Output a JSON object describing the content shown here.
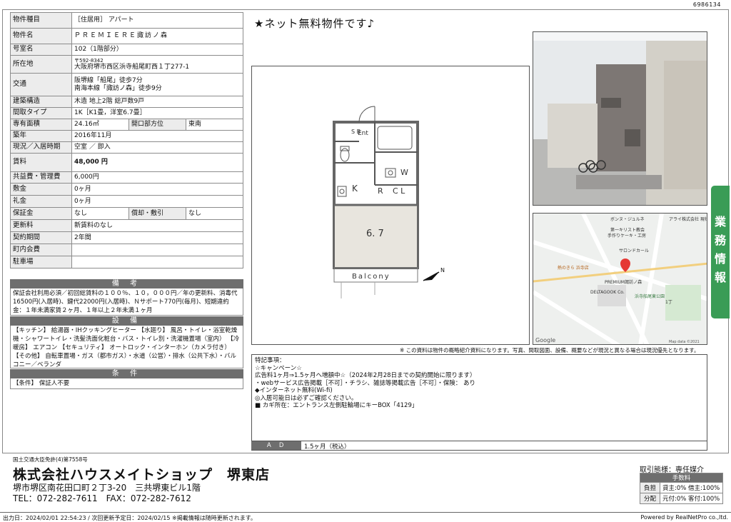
{
  "doc_id": "6986134",
  "table": {
    "rows": [
      {
        "k": "物件種目",
        "v": "［住居用］ アパート"
      },
      {
        "k": "物件名",
        "v": "ＰＲＥＭＩＥＲＥ諏訪ノ森"
      },
      {
        "k": "号室名",
        "v": "102（1階部分）"
      },
      {
        "k": "所在地",
        "zip": "〒592-8342",
        "v": "大阪府堺市西区浜寺船尾町西１丁277-1"
      },
      {
        "k": "交通",
        "v1": "阪堺線「船尾」徒歩7分",
        "v2": "南海本線「諏訪ノ森」徒歩9分"
      },
      {
        "k": "建築構造",
        "v": "木造 地上2階 総戸数9戸"
      },
      {
        "k": "間取タイプ",
        "v": "1K［K1畳，洋室6.7畳］"
      },
      {
        "k": "専有面積",
        "v": "24.16㎡",
        "k2": "開口部方位",
        "v2": "東南"
      },
      {
        "k": "築年",
        "v": "2016年11月"
      },
      {
        "k": "現況／入居時期",
        "v": "空室 ／ 即入"
      },
      {
        "k": "賃料",
        "v": "48,000 円"
      },
      {
        "k": "共益費・管理費",
        "v": "6,000円"
      },
      {
        "k": "敷金",
        "v": "0ヶ月"
      },
      {
        "k": "礼金",
        "v": "0ヶ月"
      },
      {
        "k": "保証金",
        "v": "なし",
        "k2": "償却・敷引",
        "v2": "なし"
      },
      {
        "k": "更新料",
        "v": "新賃料のなし"
      },
      {
        "k": "契約期間",
        "v": "2年間"
      },
      {
        "k": "町内会費",
        "v": ""
      },
      {
        "k": "駐車場",
        "v": ""
      }
    ]
  },
  "sections": {
    "bikou": {
      "title": "備 考",
      "text": "保証会社利用必須／初回総賃料の１００％、１０，０００円／年の更新料、消毒代16500円(入居時)、鍵代22000円(入居時)、Ｎサポート770円(毎月)、短期違約金：１年未満家賃２ヶ月、１年以上２年未満１ヶ月"
    },
    "setsubi": {
      "title": "設 備",
      "text": "【キッチン】 給湯器・IHクッキングヒーター 【水廻り】 風呂・トイレ・浴室乾燥機・シャワートイレ・洗髪洗面化粧台・バス・トイレ別・洗濯機置場（室内） 【冷暖房】 エアコン 【セキュリティ】 オートロック・インターホン（カメラ付き） 【その他】 自転車置場・ガス（都市ガス）・水道（公営）・排水（公共下水）・バルコニー／ベランダ"
    },
    "jouken": {
      "title": "条 件",
      "text": "【条件】 保証人不要"
    }
  },
  "catch": "★ネット無料物件です♪",
  "floorplan": {
    "ent": "Ent",
    "sb": "S B",
    "k": "K",
    "r": "R",
    "cl": "C L",
    "w": "W",
    "size": "6. 7",
    "balcony": "Balcony",
    "north": "N"
  },
  "map": {
    "labels": [
      "ボンヌ・ジュルネ",
      "アライ株式会社 現社屋",
      "第一キリスト教会",
      "手作りケーキ・工房",
      "サロンドカール",
      "熱のきら 浜寺店",
      "PREMIUM諏訪ノ森",
      "DELTAGOOK Co.",
      "浜寺船尾東公園",
      "1丁"
    ],
    "google": "Google",
    "mapdata": "Map data ©2021"
  },
  "side_badge": "業務情報",
  "disclaimer": "※ この資料は物件の概略紹介資料になります。写真、間取図面、設備、概要などが現況と異なる場合は現況優先となります。",
  "remarks": {
    "lines": [
      "特記事項：",
      "☆キャンペーン☆",
      "広告料1ヶ月⇒1.5ヶ月へ増額中☆（2024年2月28日までの契約開始に限ります）",
      "・webサービス広告掲載［不可］・チラシ、雑誌等掲載広告［不可］・保険： あり",
      "◆インターネット無料(Wi-fi)",
      "◎入居可能日は必ずご確認ください。",
      "■ カギ所在：エントランス左側駐輪場にキーBOX「4129」"
    ],
    "ad_label": "Ａ Ｄ",
    "ad_value": "1.5ヶ月（税込）"
  },
  "footer": {
    "license": "国土交通大臣免許(4)第7558号",
    "company": "株式会社ハウスメイトショップ　堺東店",
    "address": "堺市堺区南花田口町２丁3-20　三共堺東ビル1階",
    "tel": "TEL：072-282-7611　FAX：072-282-7612",
    "deal": "取引態様：専任媒介",
    "fee_title": "手数料",
    "fee_rows": [
      {
        "k": "負担",
        "v": "貸主:0% 借主:100%"
      },
      {
        "k": "分配",
        "v": "元付:0% 客付:100%"
      }
    ],
    "dates": "出力日：2024/02/01 22:54:23 / 次回更新予定日：2024/02/15 ※掲載情報は随時更新されます。",
    "powered": "Powered by RealNetPro co.,ltd."
  }
}
